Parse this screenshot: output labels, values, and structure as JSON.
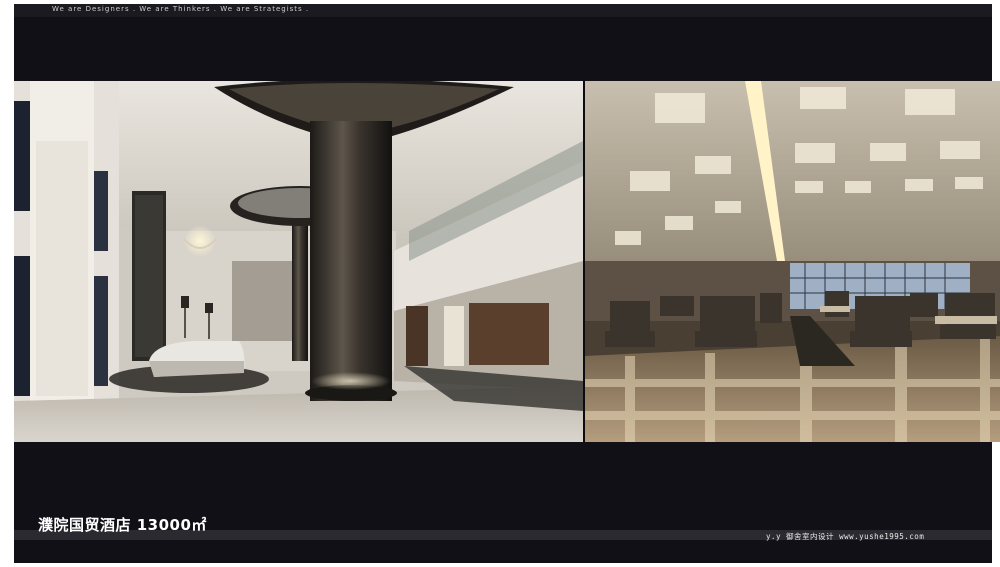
{
  "header": {
    "tagline": "We are Designers  .  We are Thinkers  .  We are Strategists ."
  },
  "images": {
    "left": {
      "subject": "hotel lobby with column and reception desk"
    },
    "right": {
      "subject": "hotel restaurant with coffered ceiling"
    }
  },
  "footer": {
    "caption": "濮院国贸酒店 13000㎡",
    "credit": "y.y  御舍室内设计   www.yushe1995.com"
  }
}
